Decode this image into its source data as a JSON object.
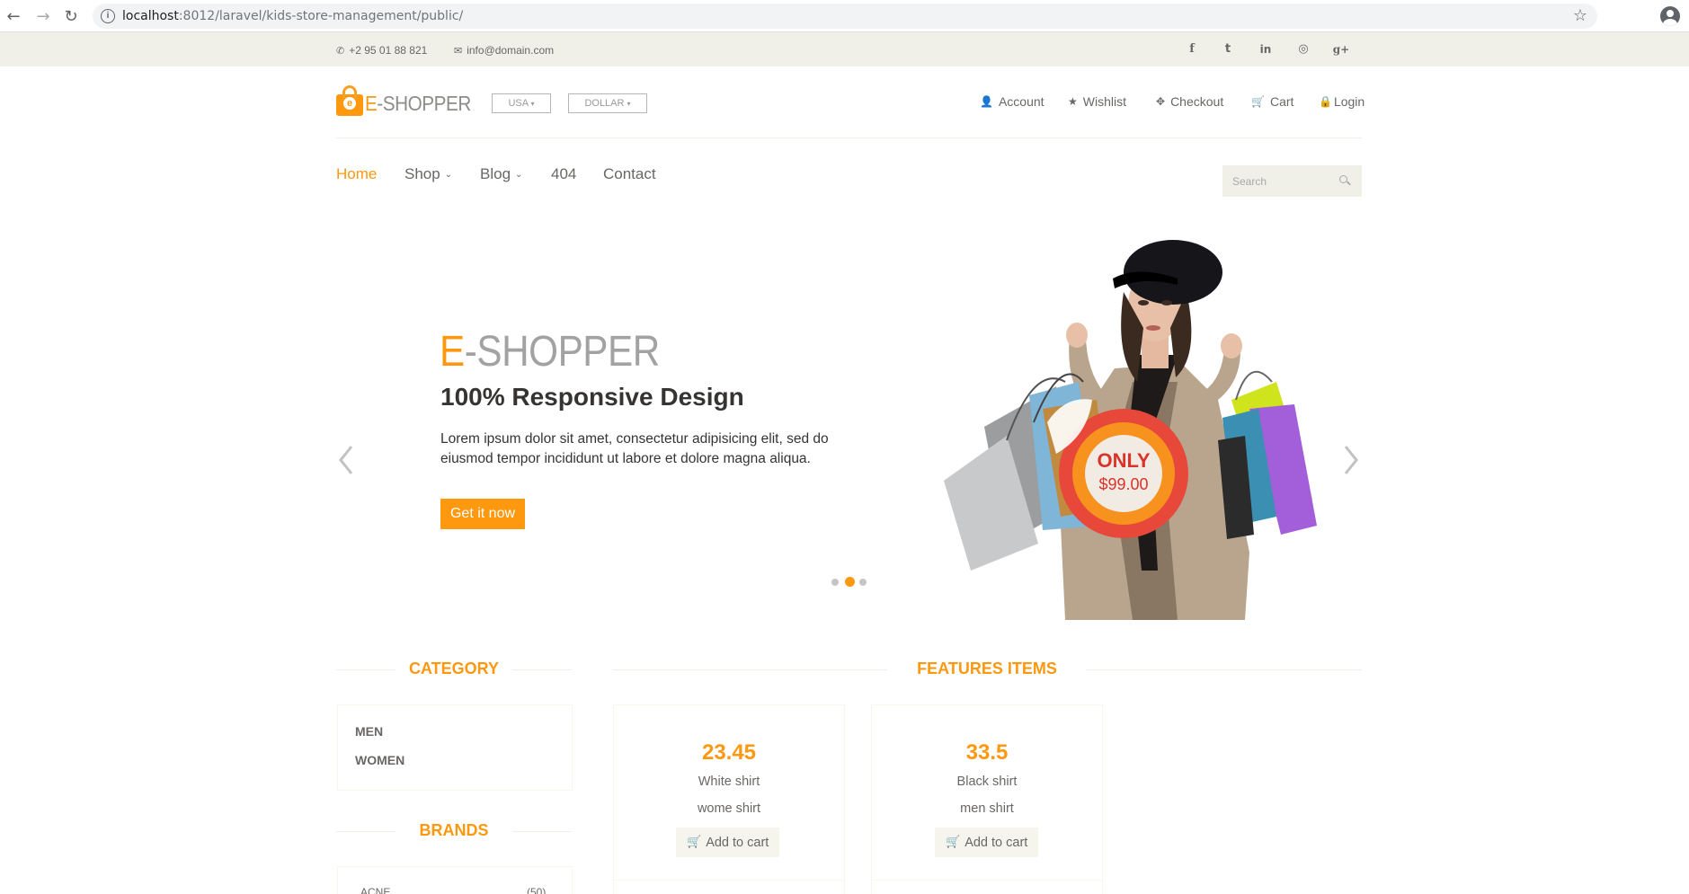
{
  "browser": {
    "url_host": "localhost",
    "url_path": ":8012/laravel/kids-store-management/public/",
    "back": "←",
    "forward": "→",
    "reload": "↻",
    "info": "i",
    "star": "☆"
  },
  "top_bar": {
    "phone_icon": "✆",
    "phone": "+2 95 01 88 821",
    "email_icon": "✉",
    "email": "info@domain.com",
    "social": [
      "f",
      "t",
      "in",
      "◎",
      "g+"
    ]
  },
  "header": {
    "logo_letter": "e",
    "logo_e": "E",
    "logo_rest": "-SHOPPER",
    "country": "USA",
    "currency": "DOLLAR",
    "caret": "▾",
    "links": [
      {
        "icon": "👤",
        "label": "Account"
      },
      {
        "icon": "★",
        "label": "Wishlist"
      },
      {
        "icon": "✥",
        "label": "Checkout"
      },
      {
        "icon": "🛒",
        "label": "Cart"
      },
      {
        "icon": "🔒",
        "label": "Login"
      }
    ]
  },
  "nav": {
    "home": "Home",
    "shop": "Shop",
    "blog": "Blog",
    "notfound": "404",
    "contact": "Contact",
    "chevron": "⌄",
    "search_placeholder": "Search"
  },
  "slider": {
    "title_e": "E",
    "title_rest": "-SHOPPER",
    "subtitle": "100% Responsive Design",
    "description": "Lorem ipsum dolor sit amet, consectetur adipisicing elit, sed do eiusmod tempor incididunt ut labore et dolore magna aliqua.",
    "cta": "Get it now",
    "badge_top": "ONLY",
    "badge_price": "$99.00",
    "active_dot": 1
  },
  "sidebar": {
    "category_title": "CATEGORY",
    "categories": [
      "MEN",
      "WOMEN"
    ],
    "brands_title": "BRANDS",
    "brands": [
      {
        "name": "ACNE",
        "count": "(50)"
      }
    ]
  },
  "features": {
    "title": "FEATURES ITEMS",
    "cart_icon": "🛒",
    "products": [
      {
        "price": "23.45",
        "name": "White shirt",
        "desc": "wome shirt",
        "button": "Add to cart"
      },
      {
        "price": "33.5",
        "name": "Black shirt",
        "desc": "men shirt",
        "button": "Add to cart"
      }
    ]
  },
  "colors": {
    "accent": "#FE980F",
    "top_bar_bg": "#F0F0E9",
    "text": "#696763",
    "heading": "#363432"
  }
}
